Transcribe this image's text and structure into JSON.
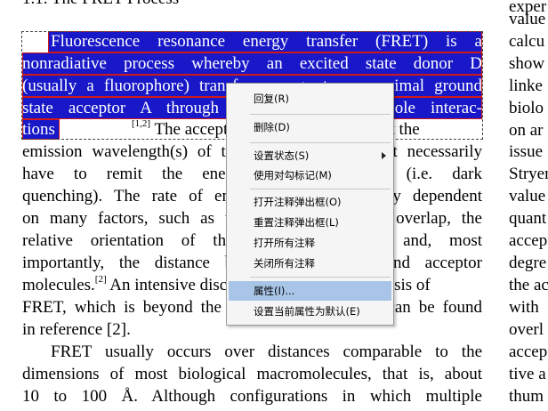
{
  "heading": "1.1. The FRET Process",
  "lines": [
    "Fluorescence resonance energy transfer (FRET) is a",
    "nonradiative process whereby an excited state donor D",
    "(usually a fluorophore) transfers energy to a proximal ground",
    "state acceptor A through long-range dipole–dipole interac-",
    "tions (Figure 1).",
    "emission wavelength(s) of the donor, but does not necessarily",
    "have to remit the energy as fluorescence (i.e. dark",
    "quenching). The rate of energy transfer is highly dependent",
    "on many factors, such as the extent of spectral overlap, the",
    "relative orientation of the transition dipoles, and, most",
    "importantly, the distance between the donor and acceptor",
    "molecules.",
    "FRET, which is beyond the scope of this review, can be found",
    "in reference [2].",
    "FRET usually occurs over distances comparable to the",
    "dimensions of most biological macromolecules, that is, about",
    "10 to 100 Å. Although configurations in which multiple"
  ],
  "line5_suffix": " The acceptor must absorb energy at the",
  "line5_sup": "[1,2]",
  "line12_sup": "[2]",
  "line12_suffix": " An intensive discussion of the physical basis of",
  "right_column": [
    "exper",
    "value",
    "calcu",
    "show",
    "linke",
    "biolo",
    "on ar",
    "issue",
    "Stryer",
    "value",
    "quant",
    "accep",
    "degre",
    "the ac",
    "with",
    "overl",
    "accep",
    "tive a",
    "thum"
  ],
  "context_menu": {
    "items": [
      {
        "label": "回复(R)"
      },
      {
        "label": "删除(D)"
      },
      {
        "label": "设置状态(S)"
      },
      {
        "label": "使用对勾标记(M)"
      },
      {
        "label": "打开注释弹出框(O)"
      },
      {
        "label": "重置注释弹出框(L)"
      },
      {
        "label": "打开所有注释"
      },
      {
        "label": "关闭所有注释"
      },
      {
        "label": "属性(I)..."
      },
      {
        "label": "设置当前属性为默认(E)"
      }
    ]
  },
  "colors": {
    "highlight": "#1818c8",
    "highlight_border": "#d01818",
    "menu_hover": "#a8c4e6"
  }
}
